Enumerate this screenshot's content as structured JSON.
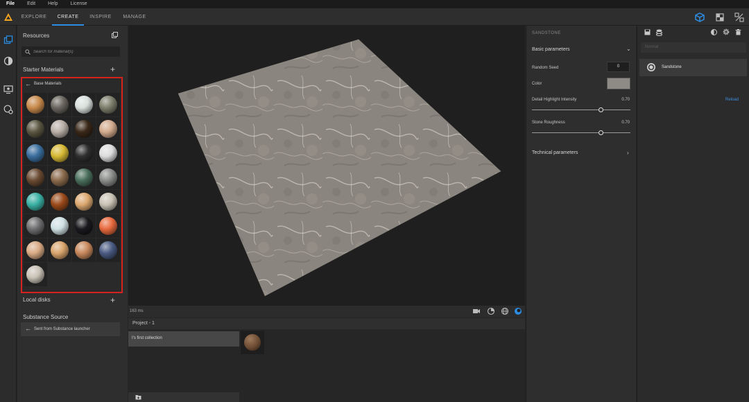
{
  "menu": [
    "File",
    "Edit",
    "Help",
    "License"
  ],
  "tabs": [
    {
      "label": "EXPLORE",
      "active": false
    },
    {
      "label": "CREATE",
      "active": true
    },
    {
      "label": "INSPIRE",
      "active": false
    },
    {
      "label": "MANAGE",
      "active": false
    }
  ],
  "accent_color": "#2b8de3",
  "highlight_border": "#d8221f",
  "resources": {
    "title": "Resources",
    "search_placeholder": "Search for material(s)",
    "starter_title": "Starter Materials",
    "base_materials_title": "Base Materials",
    "local_disks": "Local disks",
    "substance_source": "Substance Source",
    "sent_from": "Sent from Substance launcher"
  },
  "materials": [
    "#c88a4c",
    "#6a665f",
    "#d8e0dc",
    "#7e7e6c",
    "#5a5642",
    "#b8aea6",
    "#3a2818",
    "#d2aa8c",
    "#3a6e9e",
    "#d6b834",
    "#303030",
    "#dcdcdc",
    "#6a4a32",
    "#8a6a4c",
    "#4a6e5c",
    "#8a8c8a",
    "#3ab0a4",
    "#9a4a1a",
    "#dca870",
    "#c8c2b4",
    "#6e6e70",
    "#cfe0e4",
    "#1a1a1e",
    "#e86a3e",
    "#d8aa84",
    "#d8a46c",
    "#c8885c",
    "#4a5a82",
    "#c8c2b6"
  ],
  "viewport": {
    "ms": "163 ms"
  },
  "project": {
    "name": "Project - 1",
    "collection": "I's first collection"
  },
  "params": {
    "material_name": "SANDSTONE",
    "basic": "Basic parameters",
    "random_seed_label": "Random Seed",
    "random_seed_value": "0",
    "color_label": "Color",
    "swatch_color": "#8e8b87",
    "detail_label": "Detail Highlight Intensity",
    "detail_value": "0.70",
    "detail_fraction": 0.7,
    "roughness_label": "Stone Roughness",
    "roughness_value": "0.70",
    "roughness_fraction": 0.7,
    "technical": "Technical parameters"
  },
  "layers": {
    "blend_mode": "Normal",
    "layer_name": "Sandstone",
    "reload": "Reload"
  }
}
